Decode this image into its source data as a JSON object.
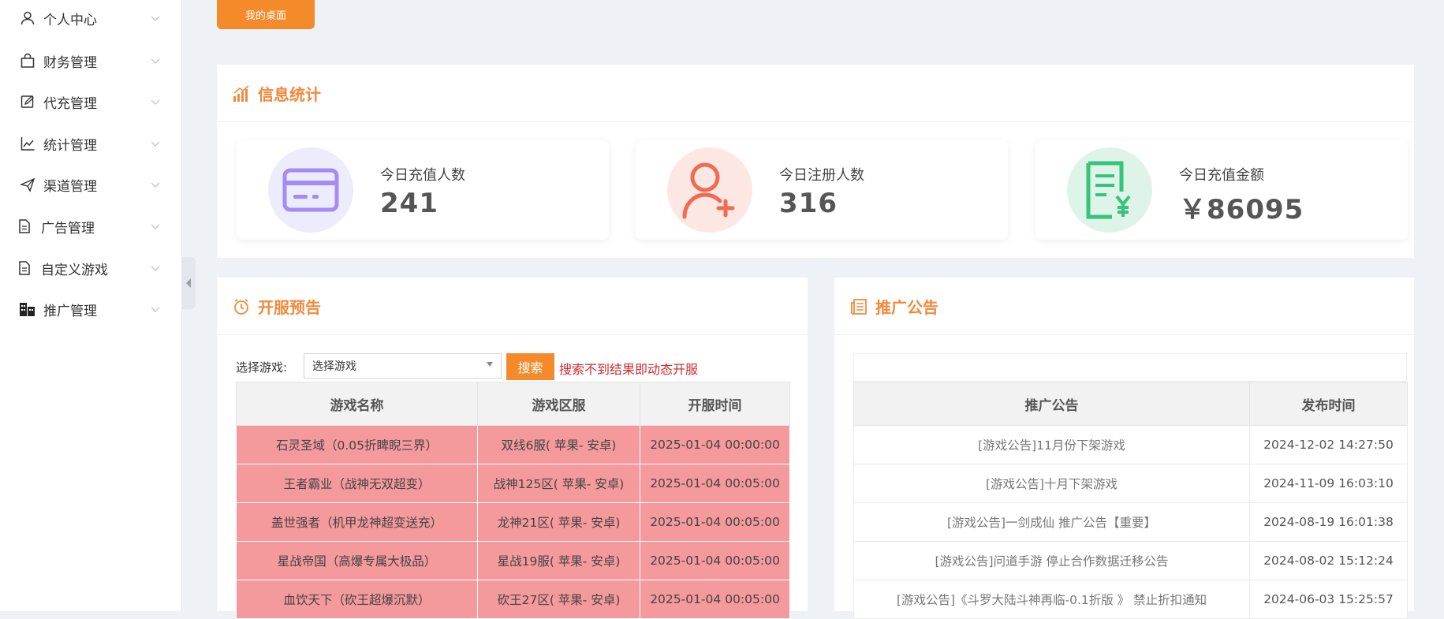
{
  "sidebar": {
    "items": [
      {
        "label": "个人中心",
        "icon": "user-icon"
      },
      {
        "label": "财务管理",
        "icon": "bag-icon"
      },
      {
        "label": "代充管理",
        "icon": "edit-icon"
      },
      {
        "label": "统计管理",
        "icon": "line-chart-icon"
      },
      {
        "label": "渠道管理",
        "icon": "send-icon"
      },
      {
        "label": "广告管理",
        "icon": "document-icon"
      },
      {
        "label": "自定义游戏",
        "icon": "document-icon"
      },
      {
        "label": "推广管理",
        "icon": "building-icon"
      }
    ]
  },
  "top_tab": {
    "label": "我的桌面"
  },
  "stats_panel": {
    "title": "信息统计",
    "cards": [
      {
        "label": "今日充值人数",
        "value": "241",
        "icon": "card-icon",
        "color": "#a58cf5"
      },
      {
        "label": "今日注册人数",
        "value": "316",
        "icon": "user-add-icon",
        "color": "#f06b52"
      },
      {
        "label": "今日充值金额",
        "value": "￥86095",
        "icon": "receipt-yen-icon",
        "color": "#36c47c"
      }
    ]
  },
  "server_panel": {
    "title": "开服预告",
    "filter_label": "选择游戏:",
    "select_value": "选择游戏",
    "search_label": "搜索",
    "hint": "搜索不到结果即动态开服",
    "columns": [
      "游戏名称",
      "游戏区服",
      "开服时间"
    ],
    "rows": [
      [
        "石灵圣域（0.05折睥睨三界）",
        "双线6服( 苹果- 安卓)",
        "2025-01-04 00:00:00"
      ],
      [
        "王者霸业（战神无双超变）",
        "战神125区( 苹果- 安卓)",
        "2025-01-04 00:05:00"
      ],
      [
        "盖世强者（机甲龙神超变送充）",
        "龙神21区( 苹果- 安卓)",
        "2025-01-04 00:05:00"
      ],
      [
        "星战帝国（高爆专属大极品）",
        "星战19服( 苹果- 安卓)",
        "2025-01-04 00:05:00"
      ],
      [
        "血饮天下（砍王超爆沉默）",
        "砍王27区( 苹果- 安卓)",
        "2025-01-04 00:05:00"
      ]
    ]
  },
  "notice_panel": {
    "title": "推广公告",
    "columns": [
      "推广公告",
      "发布时间"
    ],
    "rows": [
      [
        "[游戏公告]11月份下架游戏",
        "2024-12-02 14:27:50"
      ],
      [
        "[游戏公告]十月下架游戏",
        "2024-11-09 16:03:10"
      ],
      [
        "[游戏公告]一剑成仙 推广公告【重要】",
        "2024-08-19 16:01:38"
      ],
      [
        "[游戏公告]问道手游 停止合作数据迁移公告",
        "2024-08-02 15:12:24"
      ],
      [
        "[游戏公告]《斗罗大陆斗神再临-0.1折版 》 禁止折扣通知",
        "2024-06-03 15:25:57"
      ]
    ]
  },
  "colors": {
    "accent": "#f58a2a",
    "title_orange": "#f08a3c",
    "row_red": "#f4999c",
    "hint_red": "#cc2b2b"
  }
}
